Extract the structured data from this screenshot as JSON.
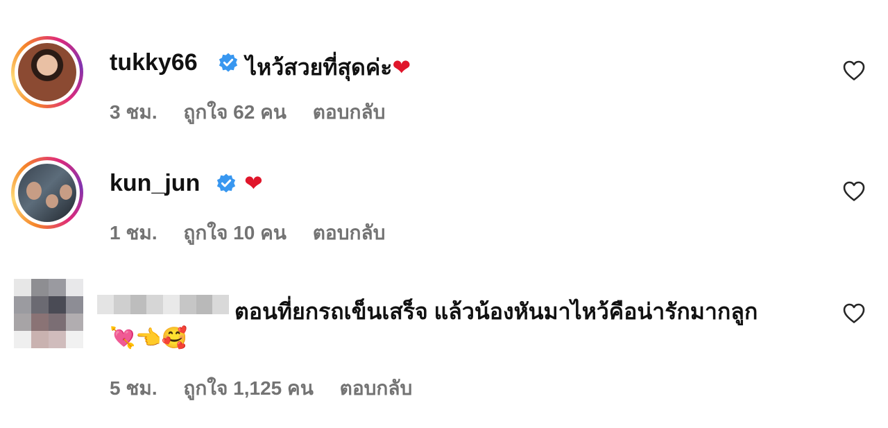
{
  "comments": [
    {
      "username": "tukky66",
      "text": "ไหว้สวยที่สุดค่ะ",
      "time": "3 ชม.",
      "likes": "ถูกใจ 62 คน",
      "reply": "ตอบกลับ",
      "verified": true,
      "emoji": "❤"
    },
    {
      "username": "kun_jun",
      "text": "",
      "time": "1 ชม.",
      "likes": "ถูกใจ 10 คน",
      "reply": "ตอบกลับ",
      "verified": true,
      "emoji": "❤"
    },
    {
      "username": "",
      "text": "ตอนที่ยกรถเข็นเสร็จ แล้วน้องหันมาไหว้คือน่ารักมากลูก",
      "text_line2": "💘👈🥰",
      "time": "5 ชม.",
      "likes": "ถูกใจ 1,125 คน",
      "reply": "ตอบกลับ",
      "verified": false
    }
  ],
  "colors": {
    "verified_badge": "#3897f0",
    "meta_text": "#737373",
    "heart_red": "#e0162b"
  },
  "icons": {
    "like": "heart-outline-icon",
    "verified": "verified-badge-icon"
  }
}
